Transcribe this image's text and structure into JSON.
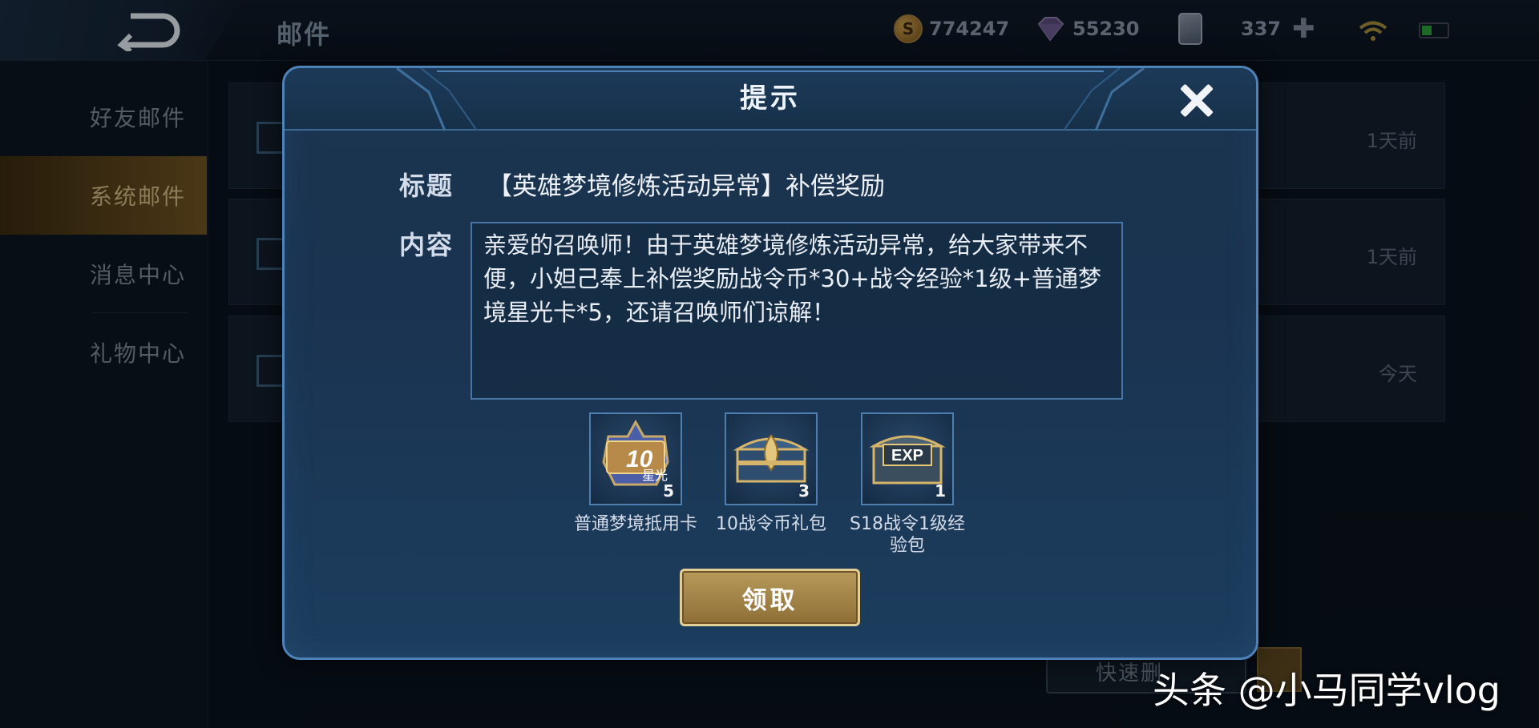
{
  "topbar": {
    "title": "邮件",
    "gold": "774247",
    "diamond": "55230",
    "tickets": "337"
  },
  "sidebar": {
    "items": [
      {
        "label": "好友邮件",
        "active": false
      },
      {
        "label": "系统邮件",
        "active": true
      },
      {
        "label": "消息中心",
        "active": false
      },
      {
        "label": "礼物中心",
        "active": false
      }
    ]
  },
  "mail_list": [
    {
      "time": "1天前"
    },
    {
      "time": "1天前"
    },
    {
      "time": "今天"
    }
  ],
  "bottom": {
    "quick_delete": "快速删"
  },
  "dialog": {
    "title": "提示",
    "subject_label": "标题",
    "subject": "【英雄梦境修炼活动异常】补偿奖励",
    "content_label": "内容",
    "content": "亲爱的召唤师！由于英雄梦境修炼活动异常，给大家带来不便，小妲己奉上补偿奖励战令币*30+战令经验*1级+普通梦境星光卡*5，还请召唤师们谅解！",
    "rewards": [
      {
        "name": "普通梦境抵用卡",
        "count": "5",
        "icon_text": "10",
        "icon_sub": "星光",
        "icon": "star-card-icon"
      },
      {
        "name": "10战令币礼包",
        "count": "3",
        "icon": "chest-icon"
      },
      {
        "name": "S18战令1级经验包",
        "count": "1",
        "icon_text": "EXP",
        "icon": "exp-chest-icon"
      }
    ],
    "claim_label": "领取"
  },
  "watermark": "头条 @小马同学vlog"
}
